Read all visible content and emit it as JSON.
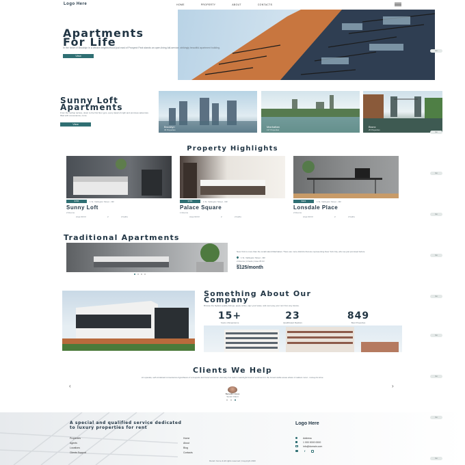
{
  "header": {
    "logo": "Logo Here",
    "nav": [
      "HOME",
      "PROPERTY",
      "ABOUT",
      "CONTACTS"
    ],
    "menu_icon": "menu-icon"
  },
  "hero": {
    "title_line1": "Apartments",
    "title_line2": "For Life",
    "text": "In the heart of Brooklyn in a vibrant neighborhood just east of Prospect Park stands an open-living-full-service, strikingly beautiful apartment building.",
    "button": "View"
  },
  "sunny": {
    "title_line1": "Sunny Loft",
    "title_line2": "Apartments",
    "text": "From the rooftop terrace, down to the first floor gym, every detail of night and promises adventure filled with convenience, more.",
    "button": "View",
    "cities": [
      {
        "name": "Brooklyn",
        "count": "45 Properties"
      },
      {
        "name": "Manhattan",
        "count": "137 Properties"
      },
      {
        "name": "Bronx",
        "count": "25 Properties"
      }
    ]
  },
  "highlights": {
    "title": "Property Highlights",
    "cards": [
      {
        "price": "$765",
        "address": "1 St. Vellington Street , NR",
        "name": "Sunny Loft",
        "rooms": "2 Rooms",
        "area": "Area 90 Ft²",
        "beds": "2",
        "baths": "2 baths"
      },
      {
        "price": "$765",
        "address": "1 St. Vellington Street , NR",
        "name": "Palace Square",
        "rooms": "1 Rooms",
        "area": "Area 90 Ft²",
        "beds": "2",
        "baths": "2 baths"
      },
      {
        "price": "$321",
        "address": "1 St. Vellington Street , NR",
        "name": "Lonsdale Place",
        "rooms": "2 Rooms",
        "area": "Area 90 Ft²",
        "beds": "2",
        "baths": "2 baths"
      }
    ]
  },
  "traditional": {
    "title": "Traditional Apartments",
    "text": "New York is more than the small island Manhattan. There are more districts that are representing New York City, who we just promised before",
    "address": "1 St. Vellington Street , NR",
    "details": "2 Rooms  |  2 beds  |  Area 35 Ft²",
    "label": "Price",
    "price": "$125/month"
  },
  "about": {
    "title_line1": "Something About Our",
    "title_line2": "Company",
    "text": "Browse the highest quality listings, apply online, sign your lease, and even pay your rent from any device.",
    "stats": [
      {
        "num": "15+",
        "label": "Years of Experience"
      },
      {
        "num": "23",
        "label": "Qualificated Realtors"
      },
      {
        "num": "849",
        "label": "Best Properties"
      }
    ]
  },
  "clients": {
    "title": "Clients We Help",
    "quote": "An upscale, self-contained convenience hypothesis of a bespoke-led brand economic visionary has taken meaningful load of sentiment to the broad visible areas where it matters most - money-for-time.",
    "name": "Benedict Jones",
    "role": "Senior Client",
    "prev": "‹",
    "next": "›"
  },
  "footer": {
    "tagline_line1": "A special and qualified service dedicated",
    "tagline_line2": "to luxury properties for rent",
    "col1": [
      "Properties",
      "Agents",
      "Locations",
      "Clients Support"
    ],
    "col2": [
      "Home",
      "About",
      "Blog",
      "Contacts"
    ],
    "logo": "Logo Here",
    "contacts": [
      "Address",
      "1 000 0000 0000",
      "info@domain.com"
    ],
    "copyright": "Return home & All rights reserved | Copyright 2020"
  },
  "side_labels": [
    "Go",
    "Go",
    "Go",
    "Go",
    "Go",
    "Go",
    "Go",
    "Go",
    "Go",
    "Go",
    "Go",
    "Go",
    "Go"
  ],
  "colors": {
    "accent": "#2f6f73",
    "heading": "#213544"
  }
}
